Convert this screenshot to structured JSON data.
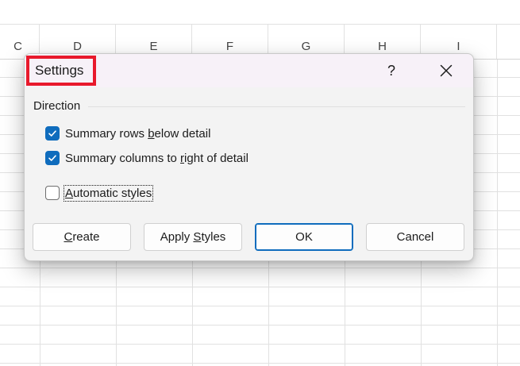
{
  "spreadsheet": {
    "columns": [
      "C",
      "D",
      "E",
      "F",
      "G",
      "H",
      "I"
    ]
  },
  "dialog": {
    "title": "Settings",
    "help_label": "?",
    "close_icon": "close-icon",
    "group": {
      "label": "Direction",
      "options": [
        {
          "pre": "Summary rows ",
          "key": "b",
          "post": "elow detail",
          "checked": true
        },
        {
          "pre": "Summary columns to ",
          "key": "r",
          "post": "ight of detail",
          "checked": true
        }
      ]
    },
    "auto_styles": {
      "pre": "",
      "key": "A",
      "post": "utomatic styles",
      "checked": false
    },
    "buttons": {
      "create": {
        "pre": "",
        "key": "C",
        "post": "reate"
      },
      "apply_styles": {
        "pre": "Apply ",
        "key": "S",
        "post": "tyles"
      },
      "ok": {
        "label": "OK"
      },
      "cancel": {
        "label": "Cancel"
      }
    },
    "accent_color": "#0f6cbd",
    "title_highlight_color": "#e8192c"
  }
}
